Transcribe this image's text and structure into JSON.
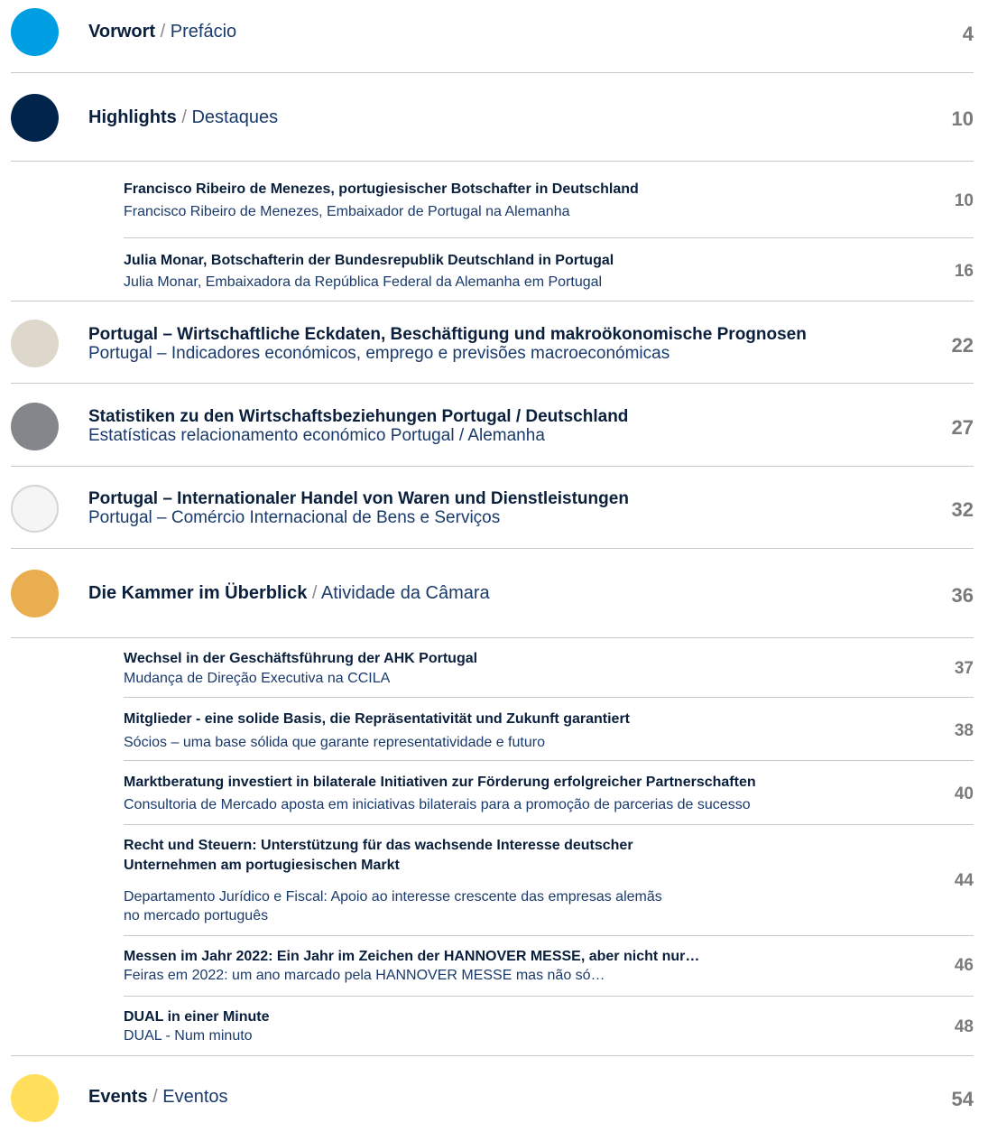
{
  "sections": {
    "vorwort": {
      "de": "Vorwort",
      "sep": "/",
      "pt": "Prefácio",
      "page": "4",
      "color": "#009fe3"
    },
    "highlights": {
      "de": "Highlights",
      "sep": "/",
      "pt": "Destaques",
      "page": "10",
      "color": "#00244a"
    },
    "eckdaten": {
      "de": "Portugal – Wirtschaftliche Eckdaten, Beschäftigung und makroökonomische Prognosen",
      "pt": "Portugal – Indicadores económicos, emprego e previsões macroeconómicas",
      "page": "22",
      "color": "#ddd8cb"
    },
    "statistiken": {
      "de": "Statistiken zu den Wirtschaftsbeziehungen Portugal / Deutschland",
      "pt": "Estatísticas relacionamento económico Portugal / Alemanha",
      "page": "27",
      "color": "#83878b"
    },
    "handel": {
      "de": "Portugal – Internationaler Handel von Waren und Dienstleistungen",
      "pt": "Portugal – Comércio Internacional de Bens e Serviços",
      "page": "32",
      "color": "#f5f5f5"
    },
    "kammer": {
      "de": "Die Kammer im Überblick",
      "sep": "/",
      "pt": "Atividade da Câmara",
      "page": "36",
      "color": "#e8ae50"
    },
    "events": {
      "de": "Events",
      "sep": "/",
      "pt": "Eventos",
      "page": "54",
      "color": "#ffdf5c"
    }
  },
  "highlights_items": [
    {
      "de": "Francisco Ribeiro de Menezes, portugiesischer Botschafter in Deutschland",
      "pt": "Francisco Ribeiro de Menezes, Embaixador de Portugal na Alemanha",
      "page": "10"
    },
    {
      "de": "Julia Monar, Botschafterin der Bundesrepublik Deutschland in Portugal",
      "pt": "Julia Monar, Embaixadora da República Federal da Alemanha em Portugal",
      "page": "16"
    }
  ],
  "kammer_items": [
    {
      "de": "Wechsel in der Geschäftsführung der AHK Portugal",
      "pt": "Mudança de Direção Executiva na CCILA",
      "page": "37"
    },
    {
      "de": "Mitglieder - eine solide Basis, die Repräsentativität und Zukunft garantiert",
      "pt": "Sócios – uma base sólida que garante representatividade e futuro",
      "page": "38"
    },
    {
      "de": "Marktberatung investiert in bilaterale Initiativen zur Förderung erfolgreicher Partnerschaften",
      "pt": "Consultoria de Mercado aposta em iniciativas bilaterais para a promoção de parcerias de sucesso",
      "page": "40"
    },
    {
      "de1": "Recht und Steuern: Unterstützung für das wachsende Interesse deutscher",
      "de2": "Unternehmen am portugiesischen Markt",
      "pt1": "Departamento Jurídico e Fiscal: Apoio ao interesse crescente das empresas alemãs",
      "pt2": "no mercado português",
      "page": "44"
    },
    {
      "de": "Messen im Jahr 2022: Ein Jahr im Zeichen der HANNOVER MESSE, aber nicht nur…",
      "pt": "Feiras em 2022: um ano marcado pela HANNOVER MESSE mas não só…",
      "page": "46"
    },
    {
      "de": "DUAL in einer Minute",
      "pt": "DUAL - Num minuto",
      "page": "48"
    }
  ]
}
